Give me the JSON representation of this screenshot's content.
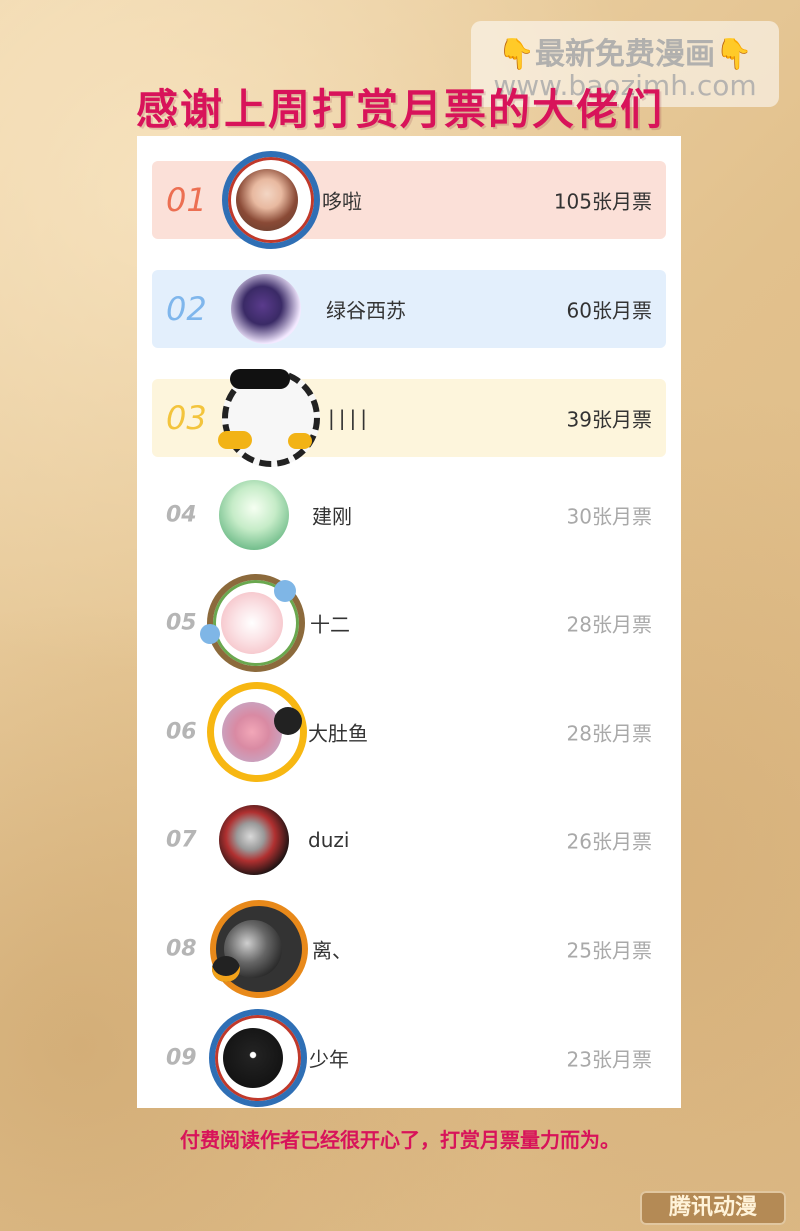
{
  "watermark": {
    "line1": "最新免费漫画",
    "line2": "www.baozimh.com",
    "icon": "pointing-down-hand-icon"
  },
  "title": "感谢上周打赏月票的大佬们",
  "ranking": [
    {
      "rank": "01",
      "name": "哆啦",
      "votes": "105张月票",
      "avatar": "portrait-woman",
      "frame": "blue-dragon-frame"
    },
    {
      "rank": "02",
      "name": "绿谷西苏",
      "votes": "60张月票",
      "avatar": "anime-character",
      "frame": "none"
    },
    {
      "rank": "03",
      "name": "||||",
      "votes": "39张月票",
      "avatar": "empty",
      "frame": "sunglasses-money-frame"
    },
    {
      "rank": "04",
      "name": "建刚",
      "votes": "30张月票",
      "avatar": "bamboo-scene",
      "frame": "none"
    },
    {
      "rank": "05",
      "name": "十二",
      "votes": "28张月票",
      "avatar": "pink-cup",
      "frame": "koala-wreath-frame"
    },
    {
      "rank": "06",
      "name": "大肚鱼",
      "votes": "28张月票",
      "avatar": "pink-blur",
      "frame": "yellow-penguin-frame"
    },
    {
      "rank": "07",
      "name": "duzi",
      "votes": "26张月票",
      "avatar": "ultraman-toy",
      "frame": "none"
    },
    {
      "rank": "08",
      "name": "离、",
      "votes": "25张月票",
      "avatar": "dark-scene",
      "frame": "flame-penguin-frame"
    },
    {
      "rank": "09",
      "name": "少年",
      "votes": "23张月票",
      "avatar": "shadow-face",
      "frame": "blue-dragon-frame"
    }
  ],
  "footer": "付费阅读作者已经很开心了，打赏月票量力而为。",
  "logo": "腾讯动漫",
  "colors": {
    "title": "#d8135a",
    "rank1_bg": "#fbe0d8",
    "rank1_text": "#ec6f52",
    "rank2_bg": "#e3effc",
    "rank2_text": "#7fb6ec",
    "rank3_bg": "#fdf5dc",
    "rank3_text": "#f3c43c",
    "rank_other_text": "#b5b5b5"
  }
}
